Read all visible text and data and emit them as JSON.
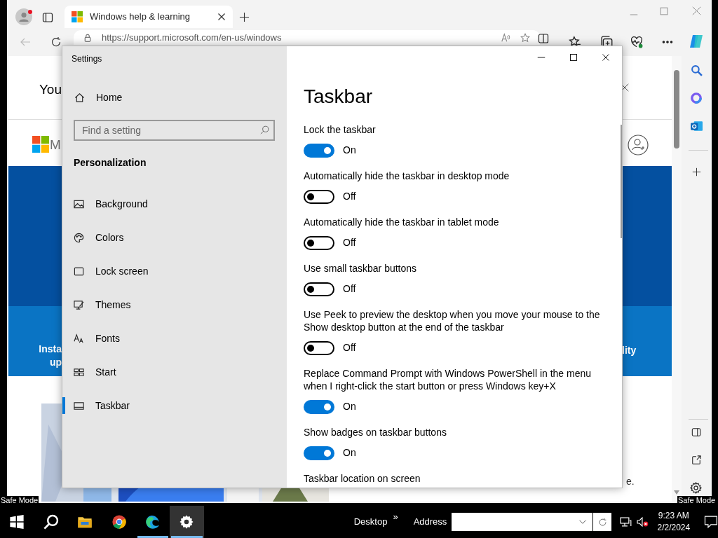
{
  "safe_mode": [
    "Safe Mode",
    "Safe Mode"
  ],
  "browser": {
    "tab_title": "Windows help & learning",
    "url": "https://support.microsoft.com/en-us/windows",
    "page": {
      "heading": "You",
      "logo_text": "M",
      "banner_lines": [
        "Insta",
        "up"
      ],
      "banner_right": "lity",
      "footer_text": "e."
    }
  },
  "settings": {
    "title": "Settings",
    "home": "Home",
    "search_placeholder": "Find a setting",
    "section": "Personalization",
    "nav": [
      {
        "kind": "background",
        "label": "Background",
        "selected": false
      },
      {
        "kind": "colors",
        "label": "Colors",
        "selected": false
      },
      {
        "kind": "lock",
        "label": "Lock screen",
        "selected": false
      },
      {
        "kind": "themes",
        "label": "Themes",
        "selected": false
      },
      {
        "kind": "fonts",
        "label": "Fonts",
        "selected": false
      },
      {
        "kind": "start",
        "label": "Start",
        "selected": false
      },
      {
        "kind": "taskbar",
        "label": "Taskbar",
        "selected": true
      }
    ],
    "page_title": "Taskbar",
    "options": [
      {
        "label": "Lock the taskbar",
        "on": true,
        "state_label": "On"
      },
      {
        "label": "Automatically hide the taskbar in desktop mode",
        "on": false,
        "state_label": "Off"
      },
      {
        "label": "Automatically hide the taskbar in tablet mode",
        "on": false,
        "state_label": "Off"
      },
      {
        "label": "Use small taskbar buttons",
        "on": false,
        "state_label": "Off"
      },
      {
        "label": "Use Peek to preview the desktop when you move your mouse to the Show desktop button at the end of the taskbar",
        "on": false,
        "state_label": "Off"
      },
      {
        "label": "Replace Command Prompt with Windows PowerShell in the menu when I right-click the start button or press Windows key+X",
        "on": true,
        "state_label": "On"
      },
      {
        "label": "Show badges on taskbar buttons",
        "on": true,
        "state_label": "On"
      }
    ],
    "last_label": "Taskbar location on screen"
  },
  "taskbar": {
    "apps": [
      {
        "kind": "start",
        "running": false,
        "selected": false
      },
      {
        "kind": "search",
        "running": false,
        "selected": false
      },
      {
        "kind": "folder",
        "running": false,
        "selected": false
      },
      {
        "kind": "chrome",
        "running": false,
        "selected": false
      },
      {
        "kind": "edge",
        "running": true,
        "selected": false
      },
      {
        "kind": "settings",
        "running": true,
        "selected": true
      }
    ],
    "desktop": "Desktop",
    "chevron": "»",
    "address": "Address",
    "time": "9:23 AM",
    "date": "2/2/2024"
  }
}
